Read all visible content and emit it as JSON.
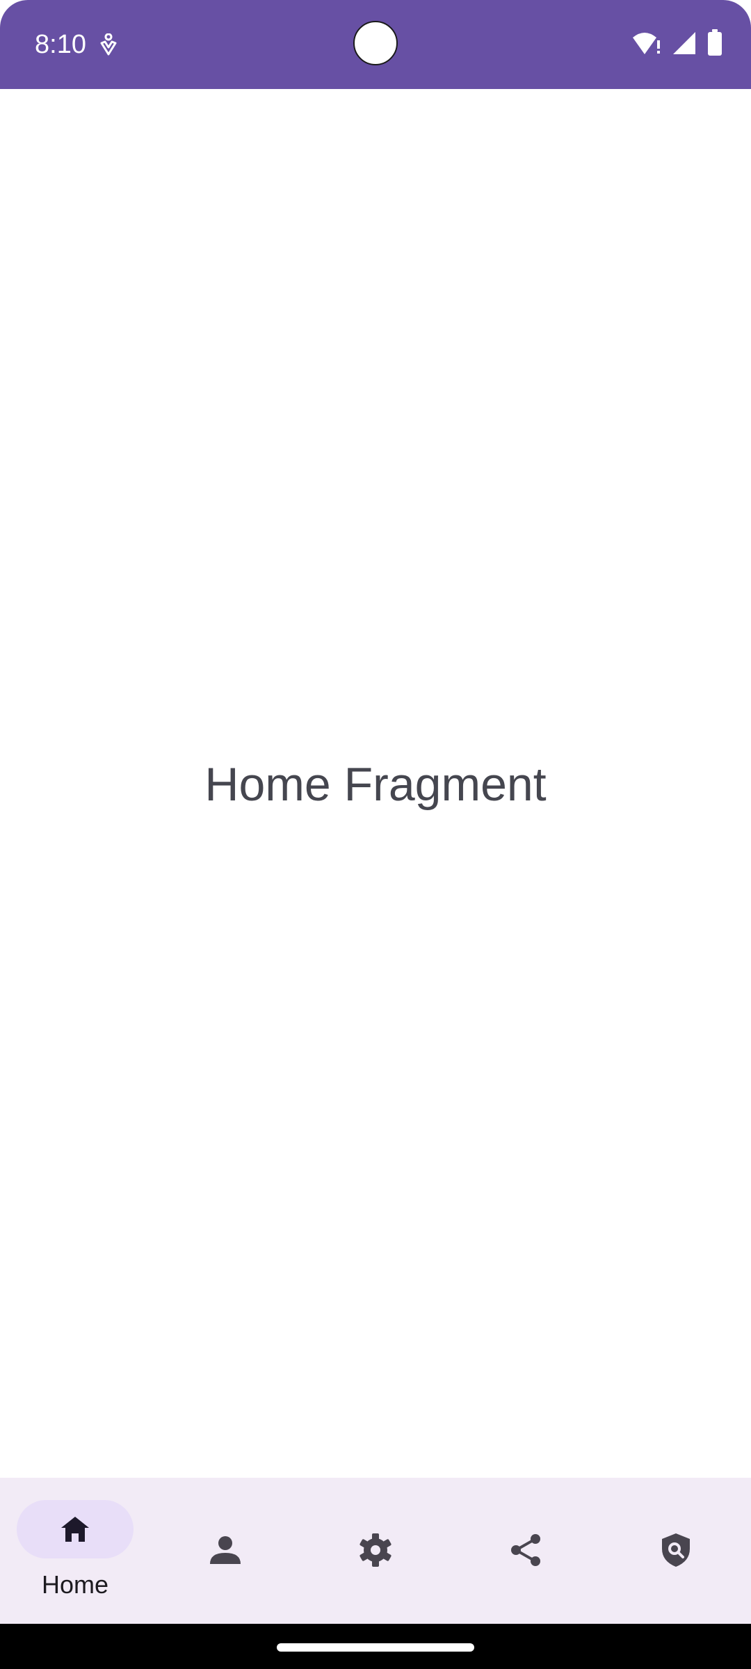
{
  "status_bar": {
    "time": "8:10",
    "background_color": "#6750a4",
    "notification_icon": "accessibility-icon",
    "wifi_icon": "wifi-alert-icon",
    "signal_icon": "cellular-signal-icon",
    "battery_icon": "battery-icon"
  },
  "main": {
    "label": "Home Fragment",
    "text_color": "#45464f"
  },
  "bottom_nav": {
    "background_color": "#f2ebf6",
    "active_indicator_color": "#e8def8",
    "items": [
      {
        "label": "Home",
        "icon": "home-icon",
        "active": true
      },
      {
        "label": "",
        "icon": "person-icon",
        "active": false
      },
      {
        "label": "",
        "icon": "settings-gear-icon",
        "active": false
      },
      {
        "label": "",
        "icon": "share-icon",
        "active": false
      },
      {
        "label": "",
        "icon": "security-search-icon",
        "active": false
      }
    ]
  }
}
